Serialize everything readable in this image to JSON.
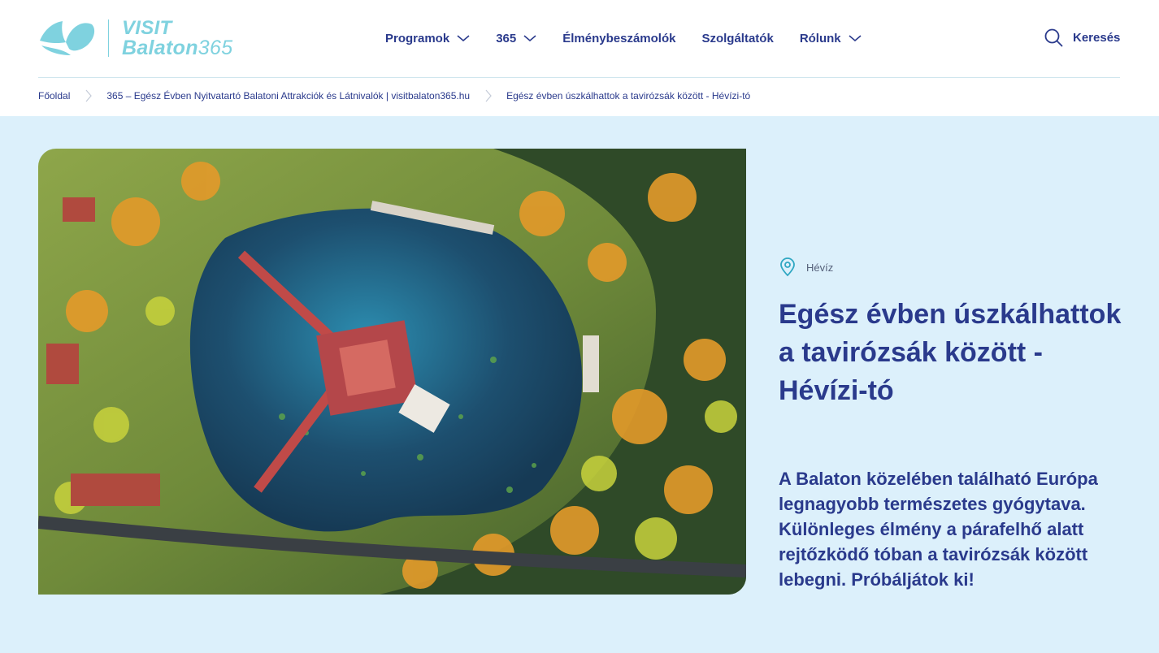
{
  "logo": {
    "line1": "VISIT",
    "line2_word": "Balaton",
    "line2_num": "365"
  },
  "nav": {
    "items": [
      {
        "label": "Programok",
        "dropdown": true
      },
      {
        "label": "365",
        "dropdown": true
      },
      {
        "label": "Élménybeszámolók",
        "dropdown": false
      },
      {
        "label": "Szolgáltatók",
        "dropdown": false
      },
      {
        "label": "Rólunk",
        "dropdown": true
      }
    ],
    "search_label": "Keresés"
  },
  "breadcrumb": [
    "Főoldal",
    "365 – Egész Évben Nyitvatartó Balatoni Attrakciók és Látnivalók | visitbalaton365.hu",
    "Egész évben úszkálhattok a tavirózsák között - Hévízi-tó"
  ],
  "article": {
    "location": "Hévíz",
    "title": "Egész évben úszkálhattok a tavirózsák között - Hévízi-tó",
    "lead": "A Balaton közelében található Európa legnagyobb természetes gyógytava. Különleges élmény a párafelhő alatt rejtőzködő tóban a tavirózsák között lebegni. Próbáljátok ki!"
  },
  "colors": {
    "brand_navy": "#2a3a8c",
    "brand_teal": "#7fd2df",
    "hero_bg": "#dcf0fb"
  },
  "icons": {
    "search": "search-icon",
    "location": "map-pin-icon",
    "chevron": "chevron-down-icon",
    "breadcrumb_sep": "chevron-right-icon"
  }
}
